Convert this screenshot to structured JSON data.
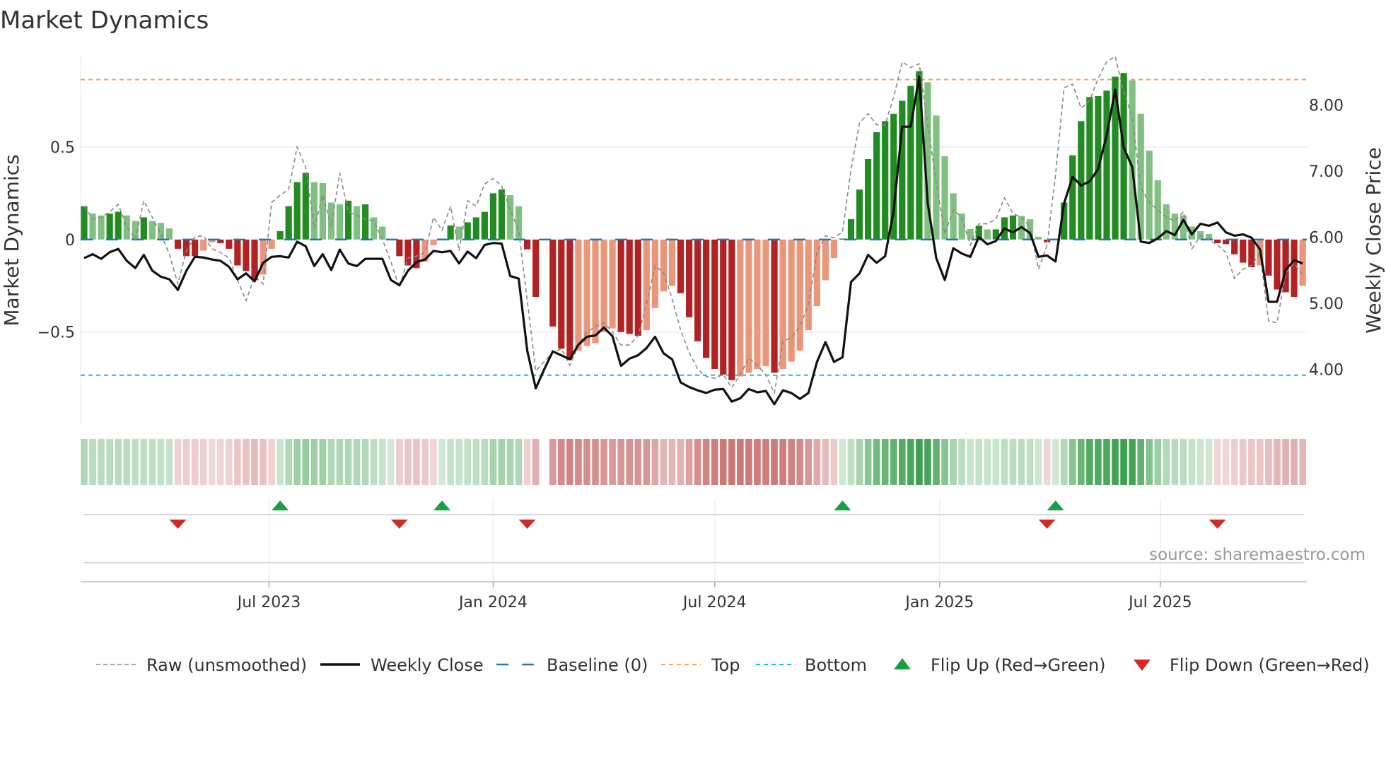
{
  "chart_data": {
    "type": "bar",
    "title": "Market Dynamics",
    "ylabel": "Market Dynamics",
    "ylabel_right": "Weekly Close Price",
    "ylim": [
      -0.99,
      0.985
    ],
    "ylim_right": [
      3.19,
      8.72
    ],
    "yticks": [
      {
        "value": 0.5,
        "label": "0.5"
      },
      {
        "value": 0,
        "label": "0"
      },
      {
        "value": -0.5,
        "label": "−0.5"
      }
    ],
    "yticks_right": [
      {
        "value": 8,
        "label": "8.00"
      },
      {
        "value": 7,
        "label": "7.00"
      },
      {
        "value": 6,
        "label": "6.00"
      },
      {
        "value": 5,
        "label": "5.00"
      },
      {
        "value": 4,
        "label": "4.00"
      }
    ],
    "x_unit": "week index (1 = first weekly bar)",
    "xticks": [
      {
        "label": "Jul 2023",
        "week": 22.7
      },
      {
        "label": "Jan 2024",
        "week": 49.0
      },
      {
        "label": "Jul 2024",
        "week": 75.0
      },
      {
        "label": "Jan 2025",
        "week": 101.4
      },
      {
        "label": "Jul 2025",
        "week": 127.3
      }
    ],
    "grid": true,
    "legend_position": "bottom",
    "top_level": 0.864,
    "bottom_level": -0.733,
    "baseline": 0,
    "momentum": [
      0.18,
      0.14,
      0.13,
      0.14,
      0.15,
      0.13,
      0.1,
      0.12,
      0.1,
      0.09,
      0.06,
      -0.05,
      -0.09,
      -0.09,
      -0.06,
      -0.015,
      -0.02,
      -0.05,
      -0.14,
      -0.17,
      -0.22,
      -0.19,
      -0.05,
      0.045,
      0.18,
      0.31,
      0.36,
      0.31,
      0.305,
      0.2,
      0.19,
      0.21,
      0.18,
      0.19,
      0.12,
      0.07,
      0,
      -0.09,
      -0.14,
      -0.155,
      -0.12,
      -0.03,
      0.005,
      0.076,
      0.07,
      0.093,
      0.12,
      0.15,
      0.25,
      0.27,
      0.24,
      0.18,
      -0.053,
      -0.31,
      null,
      -0.47,
      -0.59,
      -0.65,
      -0.6,
      -0.575,
      -0.56,
      -0.5,
      -0.48,
      -0.5,
      -0.51,
      -0.52,
      -0.49,
      -0.37,
      -0.28,
      -0.25,
      -0.29,
      -0.42,
      -0.55,
      -0.64,
      -0.7,
      -0.73,
      -0.76,
      -0.74,
      -0.72,
      -0.7,
      -0.685,
      -0.72,
      -0.7,
      -0.66,
      -0.6,
      -0.49,
      -0.36,
      -0.22,
      -0.1,
      0.005,
      0.11,
      0.27,
      0.435,
      0.58,
      0.64,
      0.68,
      0.75,
      0.83,
      0.91,
      0.85,
      0.67,
      0.45,
      0.25,
      0.14,
      0.057,
      0.075,
      0.055,
      0.055,
      0.12,
      0.13,
      0.128,
      0.11,
      0.015,
      -0.015,
      0.005,
      0.2,
      0.455,
      0.64,
      0.77,
      0.775,
      0.805,
      0.88,
      0.9,
      0.86,
      0.68,
      0.48,
      0.32,
      0.19,
      0.14,
      0.13,
      0.07,
      0.045,
      0.03,
      -0.02,
      -0.025,
      -0.08,
      -0.125,
      -0.15,
      -0.14,
      -0.195,
      -0.27,
      -0.285,
      -0.31,
      -0.25
    ],
    "raw": [
      0.18,
      0.11,
      0.12,
      0.15,
      0.19,
      0.07,
      0.0,
      0.21,
      0.12,
      0.03,
      -0.08,
      -0.24,
      -0.06,
      0.015,
      0.02,
      -0.05,
      -0.07,
      -0.1,
      -0.22,
      -0.33,
      -0.2,
      -0.24,
      0.2,
      0.24,
      0.27,
      0.5,
      0.39,
      0.06,
      0.24,
      0.07,
      0.36,
      0.15,
      0.13,
      0.11,
      0.1,
      0.0,
      -0.12,
      -0.26,
      -0.1,
      -0.09,
      -0.07,
      0.12,
      0.05,
      0.18,
      -0.06,
      0.21,
      0.18,
      0.3,
      0.33,
      0.29,
      0.16,
      0.05,
      -0.33,
      -0.71,
      -0.66,
      -0.61,
      -0.59,
      -0.68,
      -0.57,
      -0.5,
      -0.47,
      -0.45,
      -0.5,
      -0.57,
      -0.57,
      -0.52,
      -0.35,
      -0.14,
      -0.18,
      -0.32,
      -0.49,
      -0.61,
      -0.7,
      -0.74,
      -0.75,
      -0.73,
      -0.8,
      -0.73,
      -0.64,
      -0.68,
      -0.73,
      -0.83,
      -0.55,
      -0.53,
      -0.47,
      -0.35,
      -0.07,
      0.02,
      0.01,
      0.04,
      0.38,
      0.63,
      0.68,
      0.62,
      0.62,
      0.77,
      0.96,
      0.93,
      0.95,
      0.62,
      0.31,
      0.03,
      0.16,
      0.12,
      -0.03,
      0.085,
      0.085,
      0.11,
      0.225,
      0.14,
      0.12,
      0.07,
      -0.16,
      -0.03,
      0.35,
      0.82,
      0.84,
      0.71,
      0.75,
      0.87,
      0.96,
      0.99,
      0.8,
      0.66,
      0.28,
      0.2,
      0.16,
      0.12,
      0.1,
      0.15,
      -0.05,
      0.02,
      0.0,
      -0.03,
      -0.07,
      -0.21,
      -0.16,
      -0.14,
      -0.07,
      -0.44,
      -0.45,
      -0.18,
      -0.13,
      -0.19
    ],
    "close": [
      5.68,
      5.74,
      5.67,
      5.77,
      5.82,
      5.64,
      5.53,
      5.73,
      5.49,
      5.4,
      5.36,
      5.2,
      5.49,
      5.7,
      5.69,
      5.66,
      5.64,
      5.55,
      5.36,
      5.45,
      5.33,
      5.61,
      5.7,
      5.71,
      5.69,
      5.93,
      5.86,
      5.56,
      5.74,
      5.5,
      5.81,
      5.6,
      5.56,
      5.67,
      5.67,
      5.67,
      5.35,
      5.27,
      5.49,
      5.62,
      5.66,
      5.79,
      5.77,
      5.79,
      5.6,
      5.78,
      5.68,
      5.88,
      5.91,
      5.9,
      5.41,
      5.37,
      4.28,
      3.71,
      4.0,
      4.27,
      4.21,
      4.15,
      4.37,
      4.49,
      4.51,
      4.63,
      4.5,
      4.05,
      4.16,
      4.21,
      4.32,
      4.49,
      4.24,
      4.15,
      3.8,
      3.73,
      3.68,
      3.64,
      3.69,
      3.7,
      3.51,
      3.56,
      3.7,
      3.65,
      3.67,
      3.47,
      3.68,
      3.64,
      3.55,
      3.64,
      4.11,
      4.41,
      4.11,
      4.18,
      5.32,
      5.45,
      5.73,
      5.61,
      5.71,
      6.4,
      7.67,
      7.67,
      8.43,
      6.51,
      5.68,
      5.35,
      5.83,
      5.75,
      5.7,
      6.0,
      5.89,
      5.94,
      6.13,
      6.07,
      6.15,
      6.06,
      5.7,
      5.72,
      5.63,
      6.51,
      6.91,
      6.78,
      6.84,
      7.03,
      7.54,
      8.23,
      7.35,
      7.06,
      5.93,
      5.91,
      5.98,
      6.09,
      6.03,
      6.26,
      6.04,
      6.2,
      6.17,
      6.22,
      6.07,
      6.02,
      6.04,
      5.99,
      5.81,
      5.02,
      5.02,
      5.5,
      5.65,
      5.6
    ],
    "flips_up": [
      24,
      43,
      90,
      115
    ],
    "flips_down": [
      12,
      38,
      53,
      114,
      134
    ],
    "legend": [
      {
        "label": "Raw (unsmoothed)",
        "marker": "dashed-gray"
      },
      {
        "label": "Weekly Close",
        "marker": "solid-black"
      },
      {
        "label": "Baseline (0)",
        "marker": "dashed-blue"
      },
      {
        "label": "Top",
        "marker": "dotted-orange"
      },
      {
        "label": "Bottom",
        "marker": "dotted-cyan"
      },
      {
        "label": "Flip Up (Red→Green)",
        "marker": "triangle-up"
      },
      {
        "label": "Flip Down (Green→Red)",
        "marker": "triangle-down"
      }
    ],
    "source": "source: sharemaestro.com"
  },
  "colors": {
    "green_strong": "#228b22",
    "green_weak": "#80c080",
    "red_strong": "#b22222",
    "red_weak": "#e9967a",
    "close_line": "#111111",
    "raw_line": "#888888",
    "baseline": "#1f77b4",
    "top": "#f4a460",
    "bottom": "#17becf",
    "flip_up": "#1a9e44",
    "flip_down": "#d62728",
    "heat_green": "40,150,60",
    "heat_red": "190,80,80"
  }
}
